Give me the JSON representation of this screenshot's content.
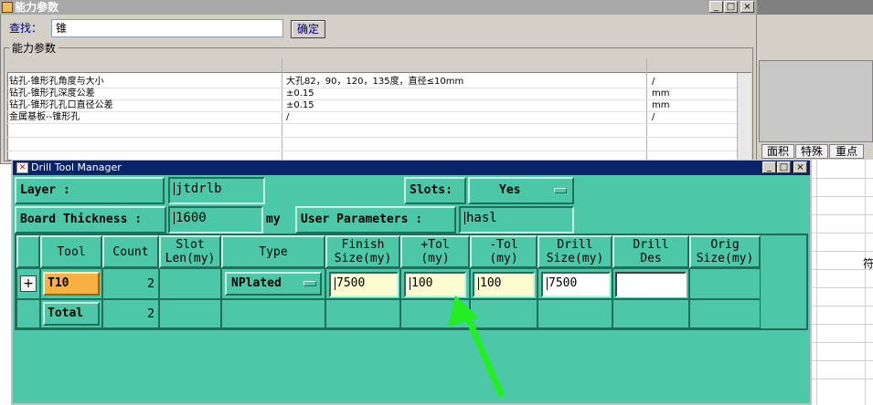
{
  "capability_window": {
    "title": "能力参数",
    "min_btn": "_",
    "max_btn": "□",
    "close_btn": "×",
    "find_label": "查找：",
    "find_value": "锥",
    "ok_button": "确定",
    "group_label": "能力参数",
    "rows": [
      {
        "name": "钻孔-锥形孔角度与大小",
        "value": "大孔82，90，120，135度，直径≤10mm",
        "unit": "/"
      },
      {
        "name": "钻孔-锥形孔深度公差",
        "value": "±0.15",
        "unit": "mm"
      },
      {
        "name": "钻孔-锥形孔孔口直径公差",
        "value": "±0.15",
        "unit": "mm"
      },
      {
        "name": "金属基板--锥形孔",
        "value": "/",
        "unit": "/"
      }
    ]
  },
  "background_window": {
    "tabs": [
      "面积",
      "特殊",
      "重点"
    ],
    "edge_label": "符"
  },
  "drill_tool_manager": {
    "title": "Drill Tool Manager",
    "min_btn": "_",
    "max_btn": "□",
    "close_btn": "×",
    "layer_label": "Layer        :",
    "layer_value": "jtdrlb",
    "slots_label": "Slots:",
    "slots_value": "Yes",
    "board_thickness_label": "Board Thickness :",
    "board_thickness_value": "1600",
    "board_thickness_unit": "my",
    "user_params_label": "User Parameters :",
    "user_params_value": "hasl",
    "columns": {
      "tool": "Tool",
      "count": "Count",
      "slot_len_1": "Slot",
      "slot_len_2": "Len(my)",
      "type": "Type",
      "finish_1": "Finish",
      "finish_2": "Size(my)",
      "ptol_1": "+Tol",
      "ptol_2": "(my)",
      "ntol_1": "-Tol",
      "ntol_2": "(my)",
      "drill_size_1": "Drill",
      "drill_size_2": "Size(my)",
      "drill_des_1": "Drill",
      "drill_des_2": "Des",
      "orig_1": "Orig",
      "orig_2": "Size(my)"
    },
    "tool_row": {
      "expand": "+",
      "tool": "T10",
      "count": "2",
      "slot_len": "",
      "type": "NPlated",
      "finish_size": "7500",
      "plus_tol": "100",
      "minus_tol": "100",
      "drill_size": "7500",
      "drill_des": "",
      "orig_size": ""
    },
    "total_row": {
      "label": "Total",
      "count": "2"
    }
  },
  "colors": {
    "dtm_background": "#4cc8a8",
    "tool_highlight": "#f8b040",
    "input_yellow": "#fdfbd0",
    "arrow": "#22ee22",
    "title_bar": "#0a246a"
  }
}
